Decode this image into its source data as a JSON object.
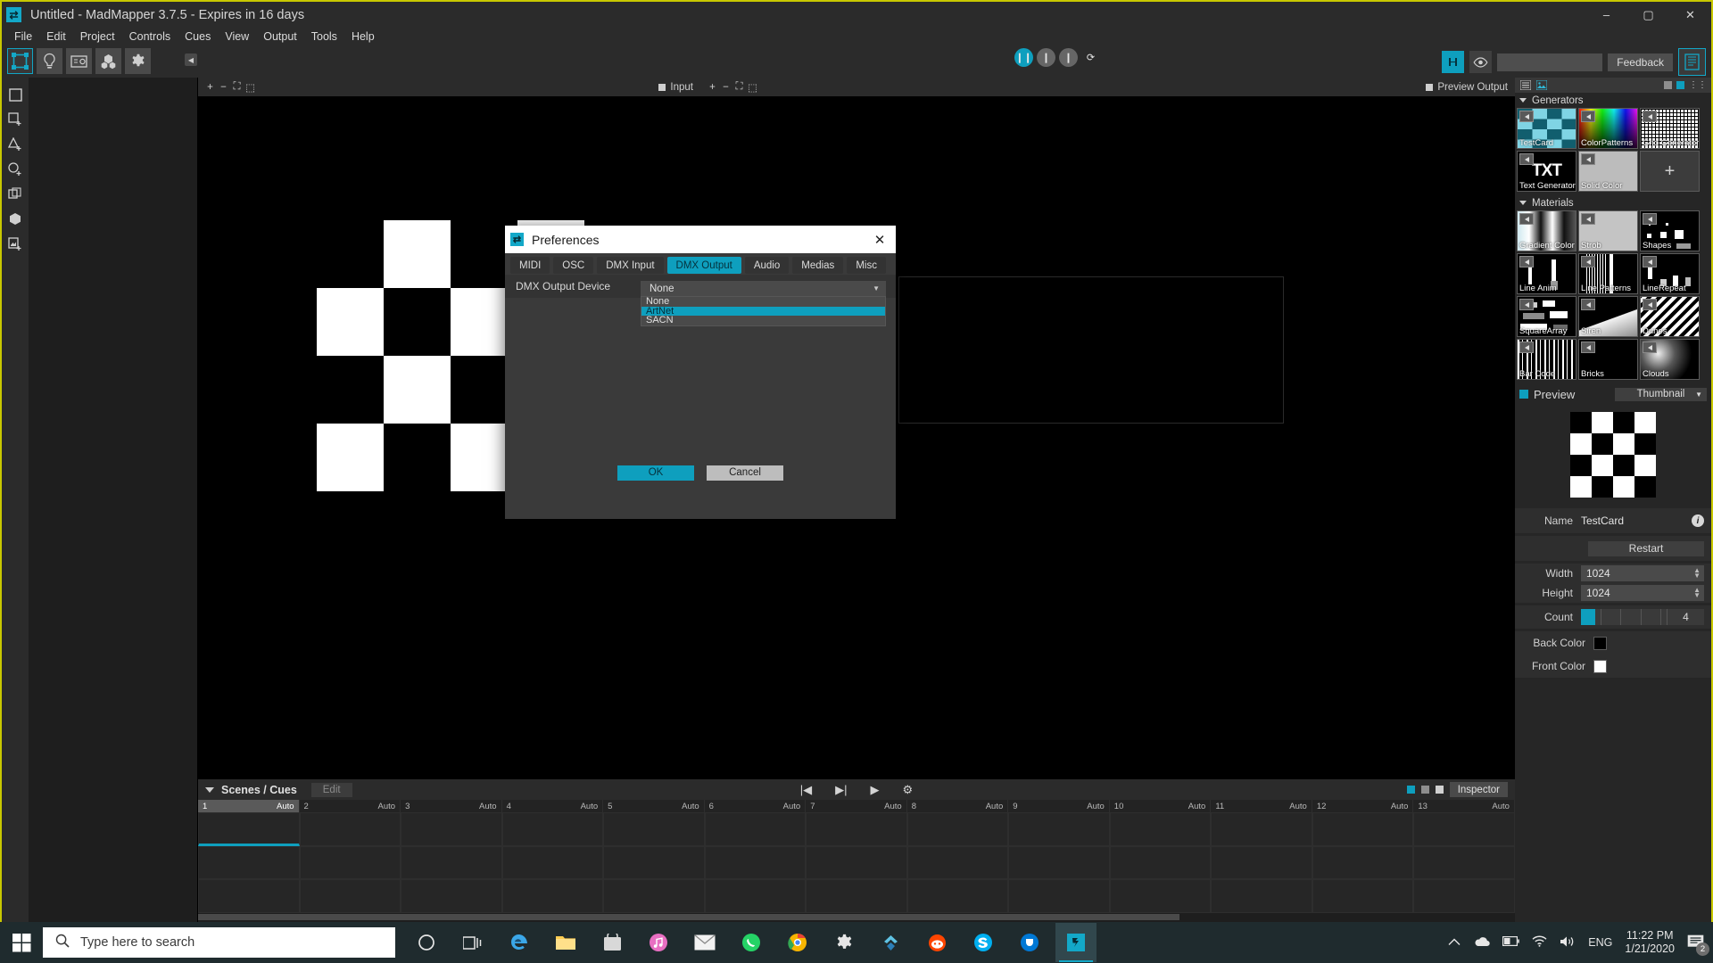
{
  "window": {
    "title": "Untitled - MadMapper 3.7.5 - Expires in 16 days",
    "app_icon": "madmapper-icon",
    "minimize": "–",
    "maximize": "▢",
    "close": "✕"
  },
  "menubar": {
    "items": [
      "File",
      "Edit",
      "Project",
      "Controls",
      "Cues",
      "View",
      "Output",
      "Tools",
      "Help"
    ]
  },
  "toolbar": {
    "tools": [
      {
        "name": "surfaces-tool",
        "active": true
      },
      {
        "name": "lights-tool",
        "active": false
      },
      {
        "name": "fixtures-tool",
        "active": false
      },
      {
        "name": "modules-tool",
        "active": false
      },
      {
        "name": "settings-tool",
        "active": false
      }
    ],
    "transport": {
      "pause": "❙❙",
      "prev": "❙",
      "next": "❙",
      "loop": "⟳"
    },
    "feedback_label": "Feedback",
    "combo_value": ""
  },
  "viewports": {
    "input": {
      "title": "Input",
      "add": "+",
      "minus": "−",
      "fit": "⛶",
      "frame": "⬚"
    },
    "preview_output": {
      "title": "Preview Output",
      "add": "+",
      "minus": "−",
      "fit": "⛶",
      "frame": "⬚"
    }
  },
  "scenes": {
    "title": "Scenes / Cues",
    "edit_label": "Edit",
    "inspector_label": "Inspector",
    "transport": {
      "start": "|◀",
      "end": "▶|",
      "play": "▶",
      "gear": "⚙"
    },
    "columns": [
      {
        "index": "1",
        "mode": "Auto",
        "selected": true
      },
      {
        "index": "2",
        "mode": "Auto",
        "selected": false
      },
      {
        "index": "3",
        "mode": "Auto",
        "selected": false
      },
      {
        "index": "4",
        "mode": "Auto",
        "selected": false
      },
      {
        "index": "5",
        "mode": "Auto",
        "selected": false
      },
      {
        "index": "6",
        "mode": "Auto",
        "selected": false
      },
      {
        "index": "7",
        "mode": "Auto",
        "selected": false
      },
      {
        "index": "8",
        "mode": "Auto",
        "selected": false
      },
      {
        "index": "9",
        "mode": "Auto",
        "selected": false
      },
      {
        "index": "10",
        "mode": "Auto",
        "selected": false
      },
      {
        "index": "11",
        "mode": "Auto",
        "selected": false
      },
      {
        "index": "12",
        "mode": "Auto",
        "selected": false
      },
      {
        "index": "13",
        "mode": "Auto",
        "selected": false
      }
    ]
  },
  "right_panel": {
    "generators": {
      "title": "Generators",
      "items": [
        {
          "label": "TestCard",
          "kind": "checker-teal"
        },
        {
          "label": "ColorPatterns",
          "kind": "color-wheel"
        },
        {
          "label": "Grid Generator",
          "kind": "grid"
        },
        {
          "label": "Text Generator",
          "kind": "txt"
        },
        {
          "label": "Solid Color",
          "kind": "solid"
        },
        {
          "label": "",
          "kind": "plus"
        }
      ]
    },
    "materials": {
      "title": "Materials",
      "items": [
        {
          "label": "Gradient Color",
          "kind": "gradient"
        },
        {
          "label": "Strob",
          "kind": "solid-light"
        },
        {
          "label": "Shapes",
          "kind": "shapes"
        },
        {
          "label": "Line Anim",
          "kind": "line-anim"
        },
        {
          "label": "Line Patterns",
          "kind": "line-patterns"
        },
        {
          "label": "LineRepeat",
          "kind": "line-repeat"
        },
        {
          "label": "SquareArray",
          "kind": "square-array"
        },
        {
          "label": "Siren",
          "kind": "siren"
        },
        {
          "label": "Dunes",
          "kind": "dunes"
        },
        {
          "label": "Bar Code",
          "kind": "barcode"
        },
        {
          "label": "Bricks",
          "kind": "bricks"
        },
        {
          "label": "Clouds",
          "kind": "clouds"
        }
      ]
    },
    "preview": {
      "label": "Preview",
      "mode": "Thumbnail",
      "caret": "▼"
    },
    "inspector": {
      "name_label": "Name",
      "name_value": "TestCard",
      "info_glyph": "i",
      "restart_label": "Restart",
      "width_label": "Width",
      "width_value": "1024",
      "height_label": "Height",
      "height_value": "1024",
      "count_label": "Count",
      "count_value": "4",
      "back_color_label": "Back Color",
      "back_color_value": "#000000",
      "front_color_label": "Front Color",
      "front_color_value": "#ffffff"
    }
  },
  "dialog": {
    "title": "Preferences",
    "icon": "madmapper-icon",
    "close_glyph": "✕",
    "tabs": [
      {
        "label": "MIDI",
        "active": false
      },
      {
        "label": "OSC",
        "active": false
      },
      {
        "label": "DMX Input",
        "active": false
      },
      {
        "label": "DMX Output",
        "active": true
      },
      {
        "label": "Audio",
        "active": false
      },
      {
        "label": "Medias",
        "active": false
      },
      {
        "label": "Misc",
        "active": false
      }
    ],
    "field_label": "DMX Output Device",
    "selected_value": "None",
    "caret": "▼",
    "options": [
      {
        "label": "None",
        "highlighted": false
      },
      {
        "label": "ArtNet",
        "highlighted": true
      },
      {
        "label": "SACN",
        "highlighted": false
      }
    ],
    "ok_label": "OK",
    "cancel_label": "Cancel"
  },
  "taskbar": {
    "search_placeholder": "Type here to search",
    "language": "ENG",
    "time": "11:22 PM",
    "date": "1/21/2020",
    "notification_count": "2",
    "apps": [
      {
        "name": "cortana-icon"
      },
      {
        "name": "task-view-icon"
      },
      {
        "name": "edge-icon"
      },
      {
        "name": "file-explorer-icon"
      },
      {
        "name": "microsoft-store-icon"
      },
      {
        "name": "itunes-icon"
      },
      {
        "name": "mail-icon"
      },
      {
        "name": "whatsapp-icon"
      },
      {
        "name": "chrome-icon"
      },
      {
        "name": "settings-icon"
      },
      {
        "name": "resilio-icon"
      },
      {
        "name": "reddit-icon"
      },
      {
        "name": "skype-icon"
      },
      {
        "name": "skype-business-icon"
      },
      {
        "name": "madmapper-icon"
      }
    ],
    "tray": [
      "chevron-up-icon",
      "onedrive-icon",
      "battery-icon",
      "wifi-icon",
      "volume-icon"
    ]
  },
  "colors": {
    "accent": "#0e9fbe",
    "window_border": "#c8c800",
    "panel": "#2b2b2b"
  }
}
